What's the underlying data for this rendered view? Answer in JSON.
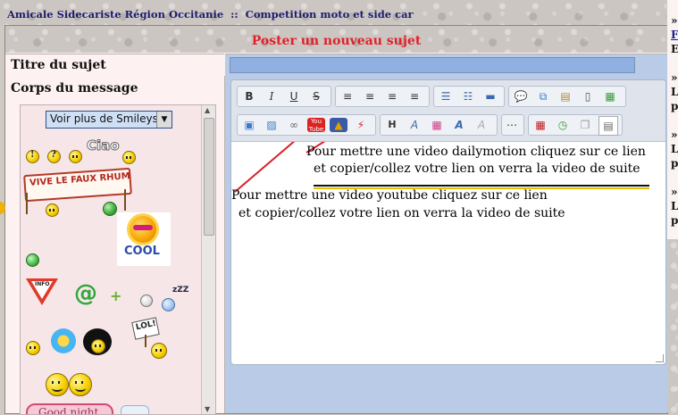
{
  "breadcrumb": {
    "site": "Amicale Sidecariste Région Occitanie",
    "separator": "::",
    "forum": "Competition moto et side car"
  },
  "form": {
    "title": "Poster un nouveau sujet",
    "subject_label": "Titre du sujet",
    "subject_value": "",
    "body_label": "Corps du message"
  },
  "smileys": {
    "select_label": "Voir plus de Smileys",
    "stickers": {
      "ciao": "Ciao",
      "vive": "VIVE LE FAUX RHUM",
      "cool": "COOL",
      "info": "INFO",
      "lol": "LOL!",
      "goodnight": "Good night"
    }
  },
  "editor": {
    "toolbar": {
      "bold": "B",
      "italic": "I",
      "underline": "U",
      "strike": "S",
      "heading": "H"
    },
    "content": {
      "dailymotion_line1": "Pour mettre une video dailymotion cliquez sur ce lien",
      "dailymotion_line2": "et copier/collez votre lien on verra la video de suite",
      "youtube_line1": "Pour mettre une video youtube cliquez sur ce lien",
      "youtube_line2": "et copier/collez votre lien on verra la video de suite"
    }
  },
  "right_sidebar": {
    "chars": [
      "»",
      "F",
      "E",
      "»",
      "L",
      "p",
      "»",
      "L",
      "p",
      "»",
      "L",
      "p"
    ]
  },
  "colors": {
    "title_red": "#e0202a",
    "breadcrumb_blue": "#1c1c6e",
    "input_blue": "#8fb0e0",
    "editor_bg": "#b9cbe6"
  }
}
